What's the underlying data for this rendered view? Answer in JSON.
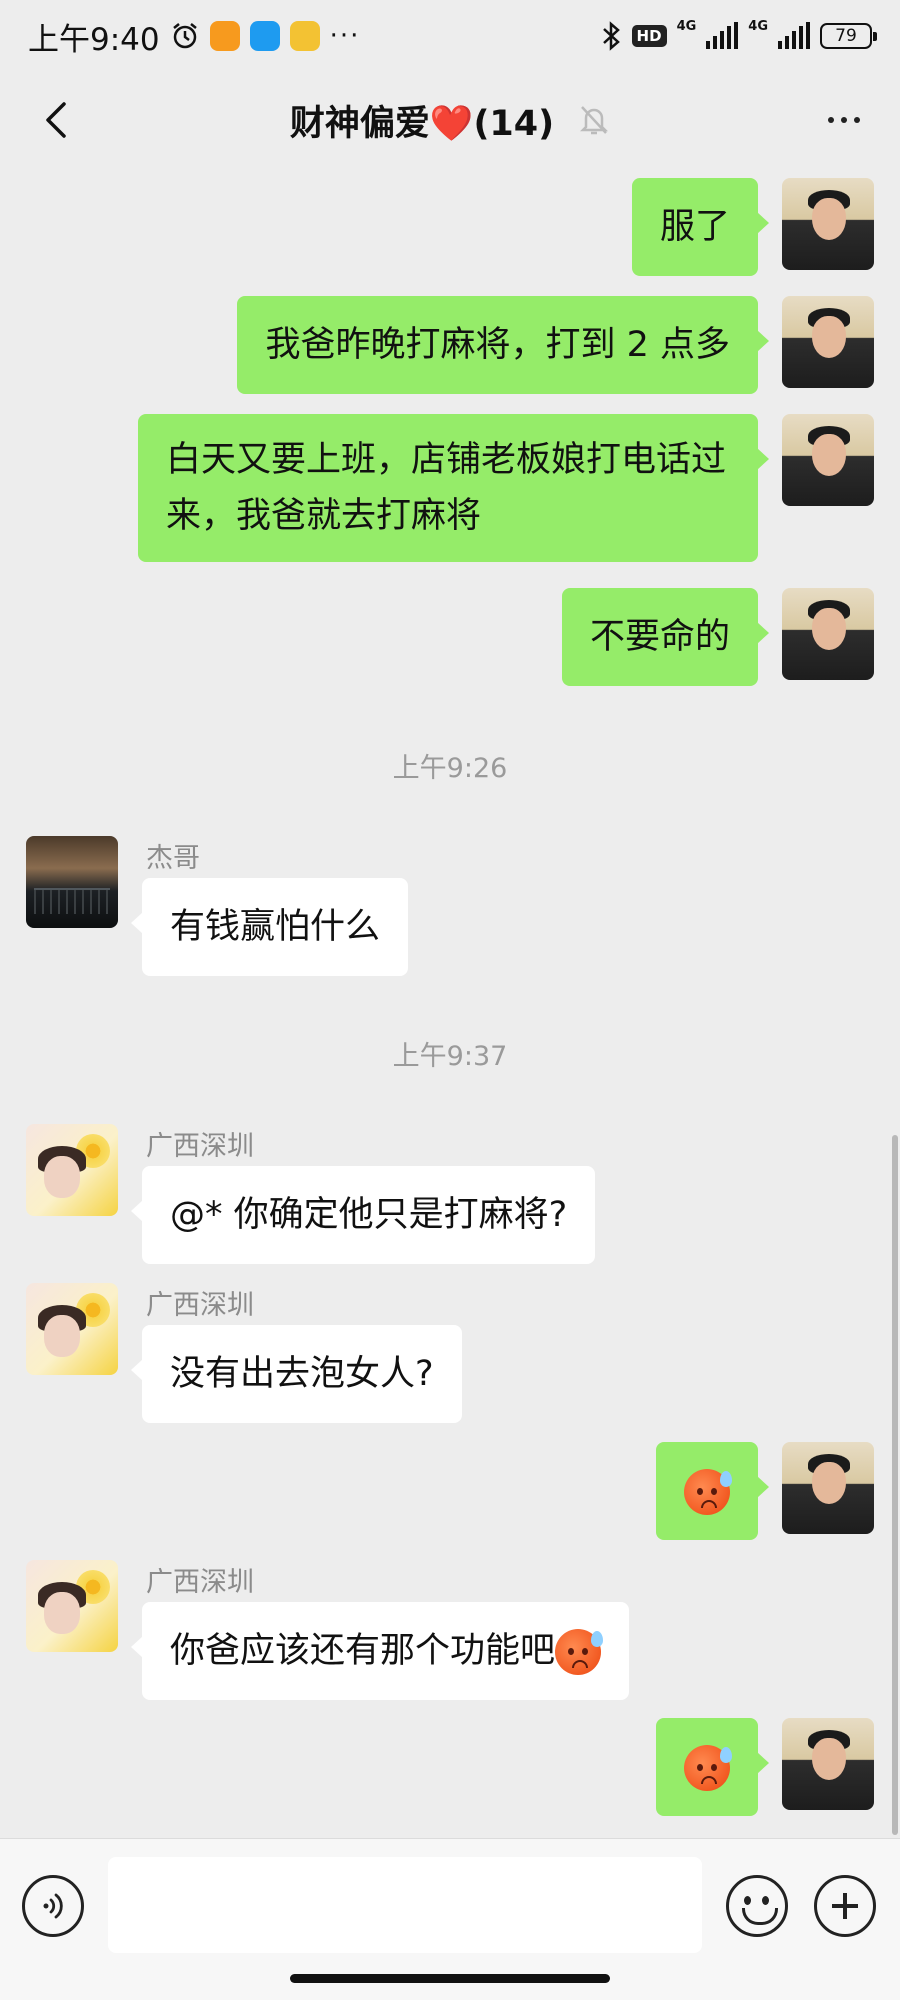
{
  "status_bar": {
    "time": "上午9:40",
    "hd_label": "HD",
    "net1": "4G",
    "net2": "4G",
    "battery": "79"
  },
  "header": {
    "title": "财神偏爱❤️(14)",
    "back_icon": "chevron-left-icon",
    "mute_icon": "bell-off-icon",
    "more_icon": "more-dots-icon"
  },
  "messages": [
    {
      "side": "right",
      "sender": "",
      "text": "服了"
    },
    {
      "side": "right",
      "sender": "",
      "text": "我爸昨晚打麻将，打到 2 点多"
    },
    {
      "side": "right",
      "sender": "",
      "text": "白天又要上班，店铺老板娘打电话过来，我爸就去打麻将"
    },
    {
      "side": "right",
      "sender": "",
      "text": "不要命的"
    },
    {
      "side": "left",
      "sender": "杰哥",
      "text": "有钱赢怕什么"
    },
    {
      "side": "left",
      "sender": "广西深圳",
      "text": "@*  你确定他只是打麻将?"
    },
    {
      "side": "left",
      "sender": "广西深圳",
      "text": "没有出去泡女人?"
    },
    {
      "side": "right",
      "sender": "",
      "emoji": "sweat-face-emoji"
    },
    {
      "side": "left",
      "sender": "广西深圳",
      "text": "你爸应该还有那个功能吧",
      "emoji": "sweat-face-emoji"
    },
    {
      "side": "right",
      "sender": "",
      "emoji": "sweat-face-emoji"
    }
  ],
  "timestamps": [
    "上午9:26",
    "上午9:37"
  ],
  "input_bar": {
    "voice_icon": "voice-icon",
    "emoji_icon": "emoji-icon",
    "plus_icon": "plus-icon",
    "placeholder": ""
  },
  "colors": {
    "background": "#ededed",
    "own_bubble": "#95ec69",
    "other_bubble": "#ffffff"
  }
}
